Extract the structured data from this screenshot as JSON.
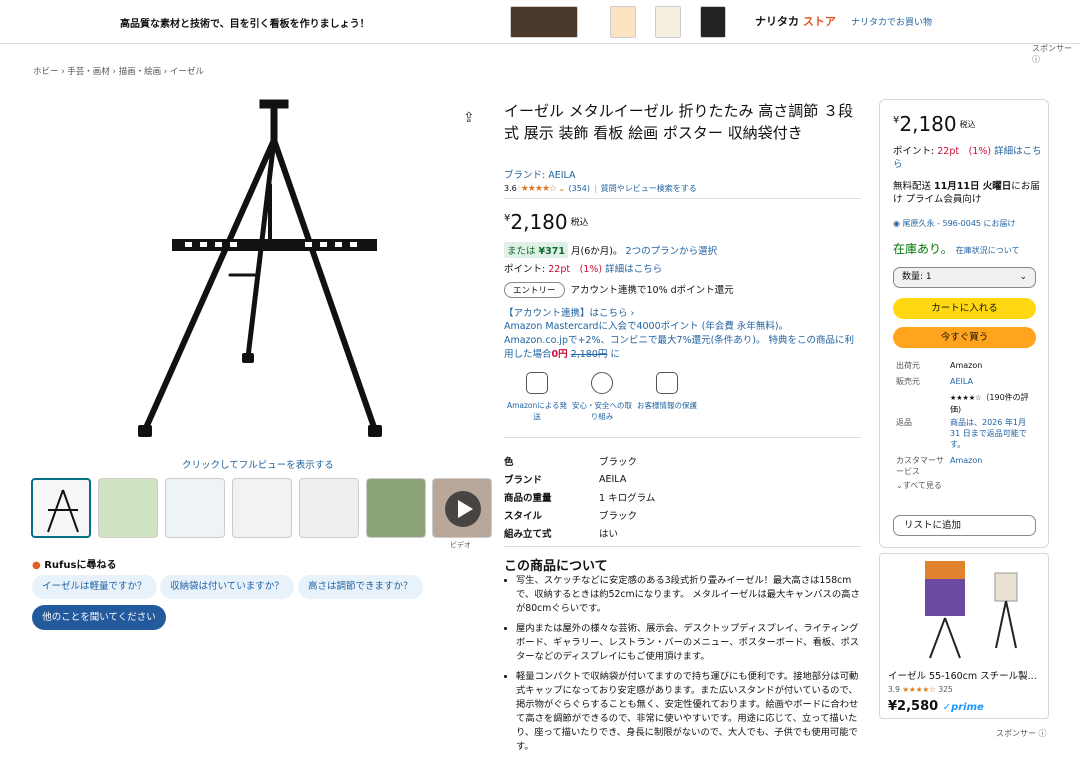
{
  "banner": {
    "tagline": "高品質な素材と技術で、目を引く看板を作りましょう！",
    "brand_black": "ナリタカ",
    "brand_orange": " ストア",
    "shop_link": "ナリタカでお買い物"
  },
  "sponsor_label": "スポンサー ⓘ",
  "breadcrumb": "ホビー › 手芸・画材 › 描画・絵画 › イーゼル",
  "fullview_link": "クリックしてフルビューを表示する",
  "video_label": "ビデオ",
  "rufus": {
    "title": "Rufusに尋ねる",
    "chips": [
      "イーゼルは軽量ですか？",
      "収納袋は付いていますか？",
      "高さは調節できますか？"
    ],
    "ask_button": "他のことを聞いてください"
  },
  "product": {
    "title": "イーゼル メタルイーゼル 折りたたみ 高さ調節 ３段式 展示 装飾 看板 絵画 ポスター 収納袋付き",
    "brand": "ブランド: AEILA",
    "rating_value": "3.6",
    "stars": 3.5,
    "rating_count": "(354)",
    "qa_link": "質問やレビュー検索をする",
    "price_symbol": "¥",
    "price": "2,180",
    "tax": "税込",
    "installment_prefix": "または",
    "installment_amount": "¥371",
    "installment_suffix": "月(6か月)。",
    "plan_link": "2つのプランから選択",
    "points_label": "ポイント:",
    "points_value": "22pt　(1%)",
    "points_link": "詳細はこちら",
    "entry_button": "エントリー",
    "entry_text": "アカウント連携で10% dポイント還元",
    "account_link": "【アカウント連携】はこちら ›",
    "mastercard_line1": "Amazon Mastercardに入会で4000ポイント (年会費 永年無料)。",
    "mastercard_line2": "Amazon.co.jpで+2%、コンビニで最大7%還元(条件あり)。 特典をこの商品に利",
    "mastercard_line3_prefix": "用した場合",
    "mastercard_line3_price": "0円",
    "mastercard_line3_strike": "2,180円",
    "mastercard_line3_suffix": " に",
    "features": [
      {
        "icon": "truck-icon",
        "label": "Amazonによる発送"
      },
      {
        "icon": "shield-check-icon",
        "label": "安心・安全への取り組み"
      },
      {
        "icon": "clipboard-check-icon",
        "label": "お客様情報の保護"
      }
    ],
    "specs": [
      {
        "key": "色",
        "value": "ブラック"
      },
      {
        "key": "ブランド",
        "value": "AEILA"
      },
      {
        "key": "商品の重量",
        "value": "1 キログラム"
      },
      {
        "key": "スタイル",
        "value": "ブラック"
      },
      {
        "key": "組み立て式",
        "value": "はい"
      }
    ],
    "about_title": "この商品について",
    "bullets": [
      "写生、スケッチなどに安定感のある3段式折り畳みイーゼル！最大高さは158cmで、収納するときは約52cmになります。 メタルイーゼルは最大キャンバスの高さが80cmぐらいです。",
      "屋内または屋外の様々な芸術、展示会、デスクトップディスプレイ、ライティングボード、ギャラリー、レストラン・バーのメニュー、ポスターボード、看板、ポスターなどのディスプレイにもご使用頂けます。",
      "軽量コンパクトで収納袋が付いてますので持ち運びにも便利です。接地部分は可動式キャップになっており安定感があります。また広いスタンドが付いているので、掲示物がぐらぐらすることも無く、安定性優れております。絵画やボードに合わせて高さを調節ができるので、非常に使いやすいです。用途に応じて、立って描いたり、座って描いたりでき、身長に制限がないので、大人でも、子供でも使用可能です。"
    ]
  },
  "buybox": {
    "price_symbol": "¥",
    "price": "2,180",
    "tax": "税込",
    "points_label": "ポイント: ",
    "points_value": "22pt　(1%)",
    "points_link": "詳細はこちら",
    "delivery_prefix": "無料配送 ",
    "delivery_date": "11月11日 火曜日",
    "delivery_suffix": "にお届け プライム会員向け",
    "location": "尾原久永 - 596-0045 にお届け",
    "stock": "在庫あり。",
    "stock_link": "在庫状況について",
    "quantity": "数量: 1",
    "add_to_cart": "カートに入れる",
    "buy_now": "今すぐ買う",
    "ship_from_label": "出荷元",
    "ship_from": "Amazon",
    "seller_label": "販売元",
    "seller": "AEILA",
    "seller_rating": "★★★★☆",
    "seller_reviews": "（190件の評価)",
    "returns_label": "返品",
    "returns": "商品は、2026 年1月31 日まで返品可能です。",
    "cs_label": "カスタマーサービス",
    "cs": "Amazon",
    "see_all": "すべて見る",
    "wishlist": "リストに追加"
  },
  "ad": {
    "title": "イーゼル 55-160cm スチール製...",
    "rating": "3.9",
    "stars": "★★★★☆",
    "reviews": "325",
    "price": "¥2,580",
    "prime": "prime"
  },
  "colors": {
    "link": "#2162a1",
    "price_red": "#cc0c39",
    "cart_yellow": "#ffd814",
    "buy_orange": "#ffa41c",
    "stock_green": "#007600"
  }
}
